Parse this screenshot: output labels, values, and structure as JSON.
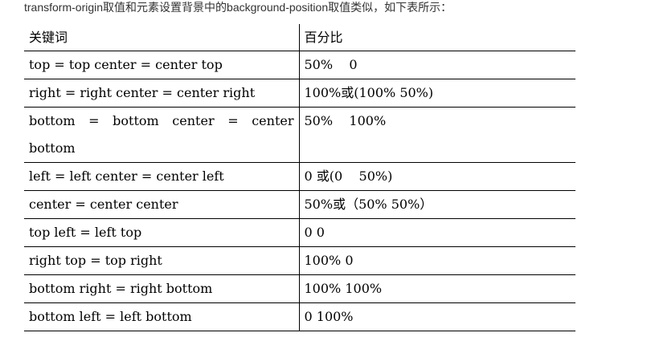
{
  "intro": "transform-origin取值和元素设置背景中的background-position取值类似，如下表所示：",
  "table": {
    "headers": [
      "关键词",
      "百分比"
    ],
    "rows": [
      [
        "top = top center = center top",
        "50%    0"
      ],
      [
        "right = right center = center right",
        "100%或(100% 50%)"
      ],
      [
        "bottom = bottom center = center bottom",
        "50%    100%"
      ],
      [
        "left = left center = center left",
        "0 或(0    50%)"
      ],
      [
        "center = center center",
        "50%或（50% 50%）"
      ],
      [
        "top left = left top",
        "0 0"
      ],
      [
        "right top = top right",
        "100% 0"
      ],
      [
        "bottom right = right bottom",
        "100% 100%"
      ],
      [
        "bottom left = left bottom",
        "0 100%"
      ]
    ]
  }
}
